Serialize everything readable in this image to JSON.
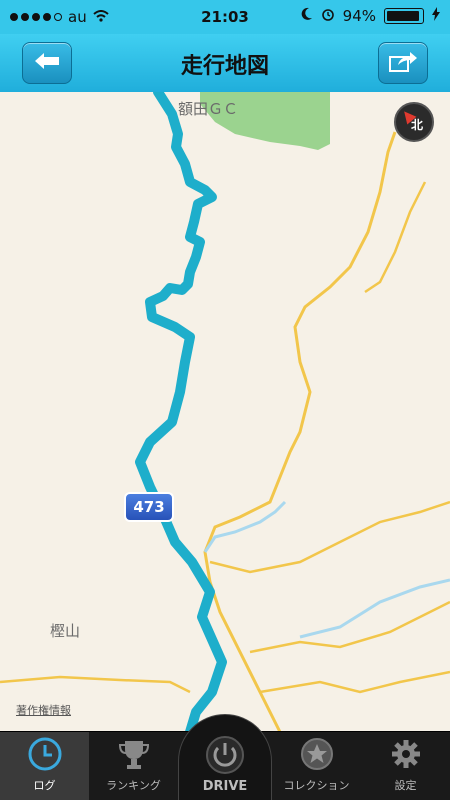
{
  "status": {
    "carrier": "au",
    "time": "21:03",
    "battery": "94%"
  },
  "header": {
    "title": "走行地図",
    "back_icon": "arrow-left-icon",
    "share_icon": "share-arrow-icon"
  },
  "map": {
    "labels": {
      "golf": "額田ＧＣ",
      "mountain": "樫山",
      "route_number": "473",
      "attribution": "著作権情報"
    },
    "compass": {
      "north": "北"
    },
    "colors": {
      "route": "#1eaecb",
      "road": "#f2c64b",
      "river": "#a9d8ee",
      "park": "#9bd38f",
      "land": "#f6f1e7"
    }
  },
  "tabs": [
    {
      "label": "ログ",
      "icon": "clock-icon",
      "active": true
    },
    {
      "label": "ランキング",
      "icon": "trophy-icon",
      "active": false
    },
    {
      "label": "DRIVE",
      "icon": "power-icon",
      "active": false
    },
    {
      "label": "コレクション",
      "icon": "star-icon",
      "active": false
    },
    {
      "label": "設定",
      "icon": "gear-icon",
      "active": false
    }
  ]
}
